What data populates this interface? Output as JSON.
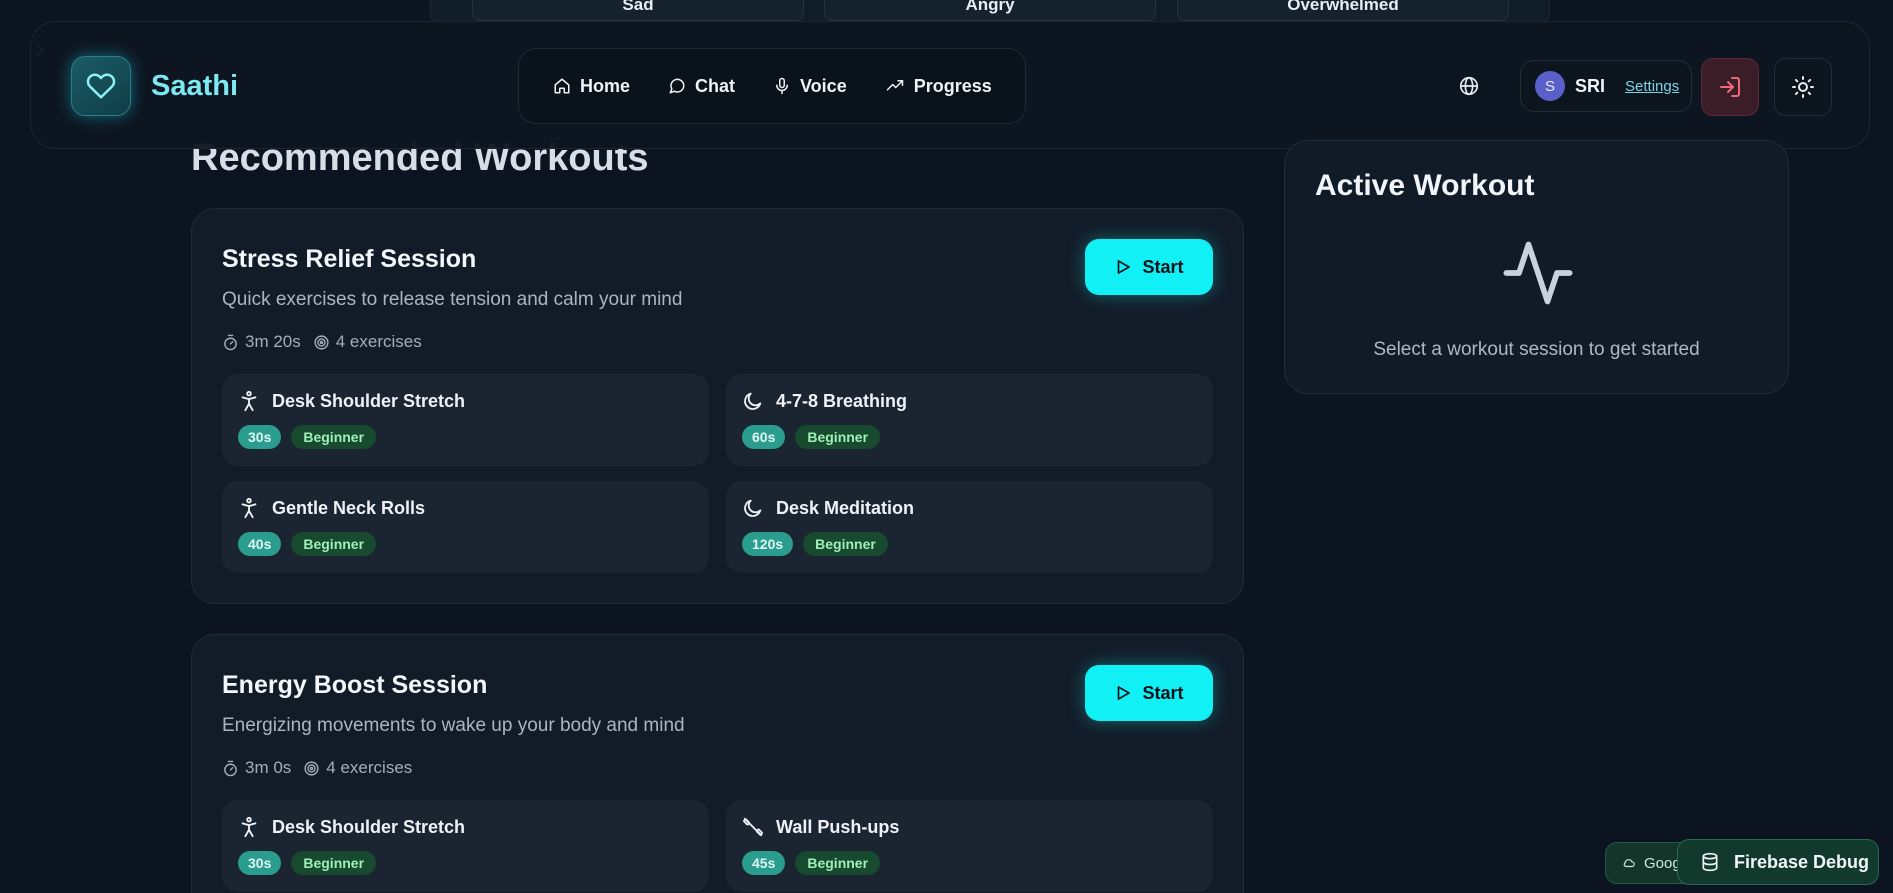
{
  "moods": [
    "Sad",
    "Angry",
    "Overwhelmed"
  ],
  "brand": {
    "name": "Saathi"
  },
  "nav": [
    {
      "label": "Home",
      "icon": "home-icon"
    },
    {
      "label": "Chat",
      "icon": "chat-bubble-icon"
    },
    {
      "label": "Voice",
      "icon": "microphone-icon"
    },
    {
      "label": "Progress",
      "icon": "trending-up-icon"
    }
  ],
  "user": {
    "initial": "S",
    "name": "SRI",
    "settings_label": "Settings"
  },
  "section_title": "Recommended Workouts",
  "sessions": [
    {
      "title": "Stress Relief Session",
      "description": "Quick exercises to release tension and calm your mind",
      "duration": "3m 20s",
      "exercise_count": "4 exercises",
      "start_label": "Start",
      "exercises": [
        {
          "name": "Desk Shoulder Stretch",
          "icon": "person-stretch-icon",
          "duration": "30s",
          "level": "Beginner"
        },
        {
          "name": "4-7-8 Breathing",
          "icon": "moon-icon",
          "duration": "60s",
          "level": "Beginner"
        },
        {
          "name": "Gentle Neck Rolls",
          "icon": "person-stretch-icon",
          "duration": "40s",
          "level": "Beginner"
        },
        {
          "name": "Desk Meditation",
          "icon": "moon-icon",
          "duration": "120s",
          "level": "Beginner"
        }
      ]
    },
    {
      "title": "Energy Boost Session",
      "description": "Energizing movements to wake up your body and mind",
      "duration": "3m 0s",
      "exercise_count": "4 exercises",
      "start_label": "Start",
      "exercises": [
        {
          "name": "Desk Shoulder Stretch",
          "icon": "person-stretch-icon",
          "duration": "30s",
          "level": "Beginner"
        },
        {
          "name": "Wall Push-ups",
          "icon": "dumbbell-icon",
          "duration": "45s",
          "level": "Beginner"
        }
      ]
    }
  ],
  "active_workout": {
    "title": "Active Workout",
    "hint": "Select a workout session to get started",
    "icon": "activity-pulse-icon"
  },
  "floating": {
    "google_label": "Goog",
    "firebase_label": "Firebase Debug"
  },
  "colors": {
    "accent": "#10f0f5",
    "background": "#0b1420",
    "card": "#121c28",
    "duration_tag": "#2a9d8f",
    "level_tag": "#174a2e"
  }
}
